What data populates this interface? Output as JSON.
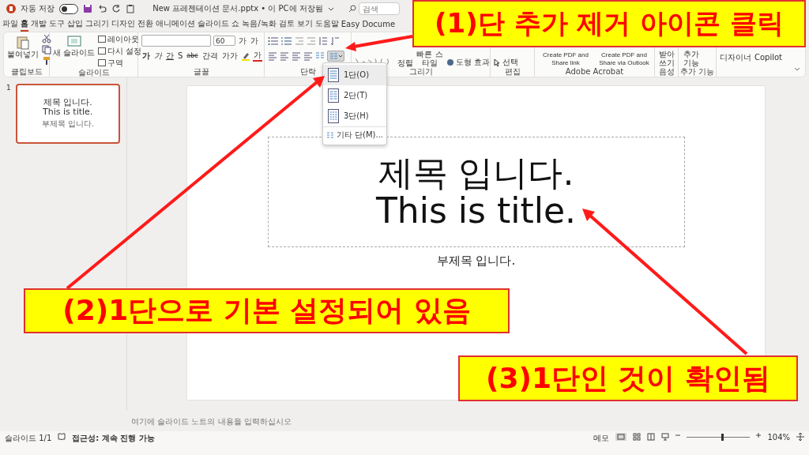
{
  "title_bar": {
    "autosave_label": "자동 저장",
    "autosave_on": false,
    "document_title": "New 프레젠테이션 문서.pptx • 이 PC에 저장됨",
    "search": {
      "placeholder": "검색"
    }
  },
  "menu_tabs": [
    {
      "label": "파일",
      "selected": false
    },
    {
      "label": "홈",
      "selected": true
    },
    {
      "label": "개발 도구",
      "selected": false
    },
    {
      "label": "삽입",
      "selected": false
    },
    {
      "label": "그리기",
      "selected": false
    },
    {
      "label": "디자인",
      "selected": false
    },
    {
      "label": "전환",
      "selected": false
    },
    {
      "label": "애니메이션",
      "selected": false
    },
    {
      "label": "슬라이드 쇼",
      "selected": false
    },
    {
      "label": "녹음/녹화",
      "selected": false
    },
    {
      "label": "검토",
      "selected": false
    },
    {
      "label": "보기",
      "selected": false
    },
    {
      "label": "도움말",
      "selected": false
    },
    {
      "label": "Easy Docume",
      "selected": false
    }
  ],
  "ribbon": {
    "groups": [
      {
        "kind": "clipboard",
        "label": "클립보드",
        "items": [
          "붙여넣기"
        ]
      },
      {
        "kind": "slides",
        "label": "슬라이드",
        "items": [
          "새 슬라이드",
          "레이아웃",
          "다시 설정",
          "구역"
        ]
      },
      {
        "kind": "font",
        "label": "글꼴",
        "font_size": "60",
        "items": [
          "가",
          "가",
          "가",
          "가",
          "간",
          "S",
          "abc",
          "간격",
          "가가",
          "가"
        ]
      },
      {
        "kind": "paragraph",
        "label": "단락",
        "columns_expanded": true
      },
      {
        "kind": "drawing",
        "label": "그리기",
        "items": [
          "정렬",
          "빠른 스타일",
          "도형 효과"
        ]
      },
      {
        "kind": "editing",
        "label": "편집",
        "items": [
          "선택"
        ]
      },
      {
        "kind": "acrobat",
        "label": "Adobe Acrobat",
        "items": [
          "Create PDF and Share link",
          "Create PDF and Share via Outlook"
        ]
      },
      {
        "kind": "voice",
        "label": "음성",
        "items": [
          "받아쓰기"
        ]
      },
      {
        "kind": "addins",
        "label": "추가 기능",
        "items": [
          "추가 기능"
        ]
      },
      {
        "kind": "assistants",
        "items": [
          "디자이너",
          "Copilot"
        ]
      }
    ]
  },
  "columns_menu": {
    "items": [
      {
        "label": "1단(O)",
        "selected": true
      },
      {
        "label": "2단(T)",
        "selected": false
      },
      {
        "label": "3단(H)",
        "selected": false
      }
    ],
    "more": "기타 단(M)..."
  },
  "thumbnails": [
    {
      "number": "1",
      "selected": true,
      "title": "제목 입니다.",
      "title_en": "This is title.",
      "subtitle": "부제목 입니다."
    }
  ],
  "slide": {
    "title": "제목 입니다.",
    "title_en": "This is title.",
    "subtitle": "부제목 입니다."
  },
  "notes": {
    "placeholder": "여기에 슬라이드 노트의 내용을 입력하십시오"
  },
  "status_bar": {
    "slide_counter": "슬라이드 1/1",
    "accessibility": "접근성: 계속 진행 가능",
    "notes_button": "메모",
    "zoom": {
      "level": 0.55,
      "reading": "104%"
    }
  },
  "annotations": [
    {
      "text": "(1)단 추가 제거 아이콘 클릭"
    },
    {
      "text": "(2)1단으로 기본 설정되어 있음"
    },
    {
      "text": "(3)1단인 것이 확인됨"
    }
  ]
}
